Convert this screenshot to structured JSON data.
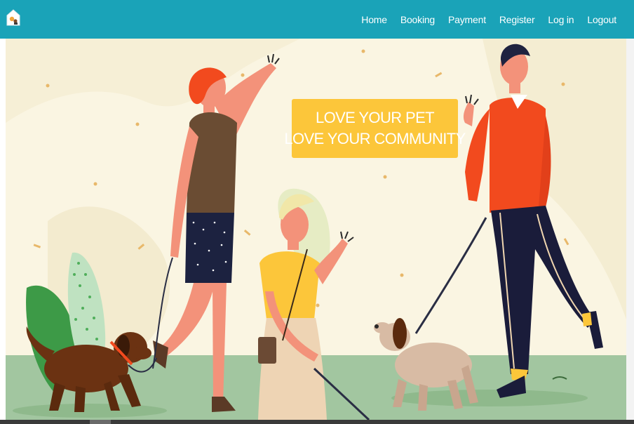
{
  "nav": {
    "logo_icon": "house-pets-logo-icon",
    "links": [
      "Home",
      "Booking",
      "Payment",
      "Register",
      "Log in",
      "Logout"
    ]
  },
  "hero": {
    "banner_line1": "LOVE YOUR PET",
    "banner_line2": "LOVE YOUR COMMUNITY",
    "illustration": "people-walking-dogs-illustration"
  },
  "colors": {
    "navbar": "#1aa3b8",
    "banner": "#fcc63a",
    "hero_background": "#faf5e2",
    "ground": "#a2c6a0"
  }
}
